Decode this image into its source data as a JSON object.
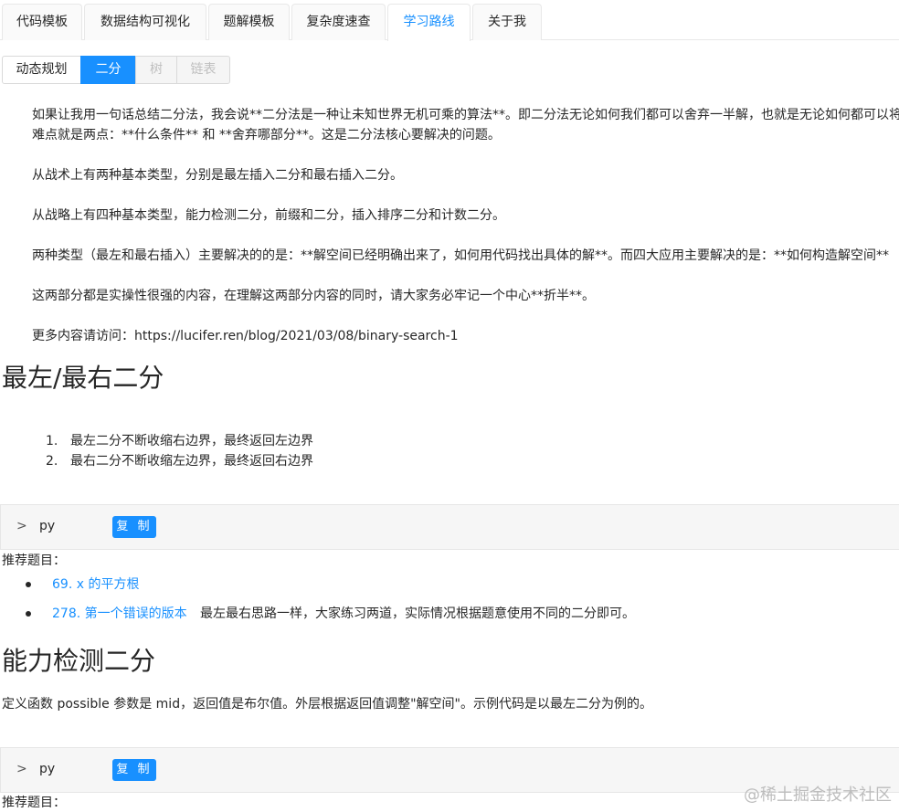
{
  "main_tabs": [
    "代码模板",
    "数据结构可视化",
    "题解模板",
    "复杂度速查",
    "学习路线",
    "关于我"
  ],
  "sub_tabs": [
    "动态规划",
    "二分",
    "树",
    "链表"
  ],
  "intro": {
    "p1_line1": "如果让我用一句话总结二分法，我会说**二分法是一种让未知世界无机可乘的算法**。即二分法无论如何我们都可以舍弃一半解，也就是无论如何都可以将",
    "p1_line2": "难点就是两点：**什么条件** 和 **舍弃哪部分**。这是二分法核心要解决的问题。",
    "p2": "从战术上有两种基本类型，分别是最左插入二分和最右插入二分。",
    "p3": "从战略上有四种基本类型，能力检测二分，前缀和二分，插入排序二分和计数二分。",
    "p4": "两种类型（最左和最右插入）主要解决的的是：**解空间已经明确出来了，如何用代码找出具体的解**。而四大应用主要解决的是：**如何构造解空间**",
    "p5": "这两部分都是实操性很强的内容，在理解这两部分内容的同时，请大家务必牢记一个中心**折半**。",
    "p6": "更多内容请访问：https://lucifer.ren/blog/2021/03/08/binary-search-1"
  },
  "section1": {
    "title": "最左/最右二分",
    "items": [
      {
        "num": "1.",
        "text": "最左二分不断收缩右边界，最终返回左边界"
      },
      {
        "num": "2.",
        "text": "最右二分不断收缩左边界，最终返回右边界"
      }
    ],
    "code_lang": "py",
    "copy_label": "复 制",
    "recommend_label": "推荐题目：",
    "recommend": [
      {
        "link": "69. x 的平方根",
        "note": ""
      },
      {
        "link": "278. 第一个错误的版本",
        "note": "最左最右思路一样，大家练习两道，实际情况根据题意使用不同的二分即可。"
      }
    ]
  },
  "section2": {
    "title": "能力检测二分",
    "desc": "定义函数 possible 参数是 mid，返回值是布尔值。外层根据返回值调整\"解空间\"。示例代码是以最左二分为例的。",
    "code_lang": "py",
    "copy_label": "复 制",
    "recommend_label": "推荐题目："
  },
  "watermark": "@稀土掘金技术社区",
  "colors": {
    "accent": "#1890ff",
    "text": "#262626",
    "disabled": "#bfbfbf"
  }
}
